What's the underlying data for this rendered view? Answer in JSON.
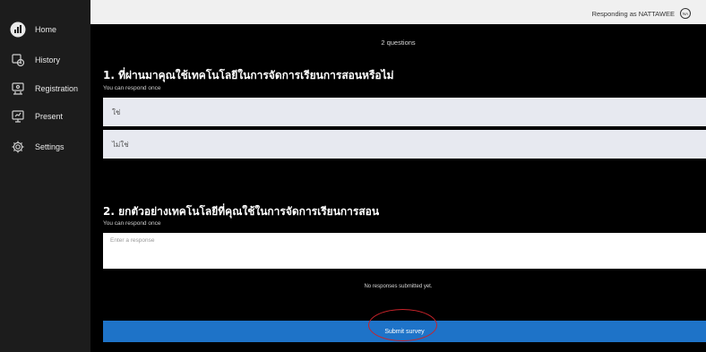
{
  "sidebar": {
    "items": [
      {
        "label": "Home",
        "icon": "home-logo-icon"
      },
      {
        "label": "History",
        "icon": "history-icon"
      },
      {
        "label": "Registration",
        "icon": "registration-icon"
      },
      {
        "label": "Present",
        "icon": "present-icon"
      },
      {
        "label": "Settings",
        "icon": "settings-gear-icon"
      }
    ]
  },
  "header": {
    "responding_as": "Responding as NATTAWEE",
    "avatar_initials": "NA"
  },
  "survey": {
    "question_count": "2 questions",
    "questions": [
      {
        "title": "1. ที่ผ่านมาคุณใช้เทคโนโลยีในการจัดการเรียนการสอนหรือไม่",
        "subtitle": "You can respond once",
        "options": [
          "ใช่",
          "ไม่ใช่"
        ]
      },
      {
        "title": "2. ยกตัวอย่างเทคโนโลยีที่คุณใช้ในการจัดการเรียนการสอน",
        "subtitle": "You can respond once",
        "placeholder": "Enter a response",
        "status": "No responses submitted yet."
      }
    ],
    "submit_label": "Submit survey"
  },
  "colors": {
    "sidebar_bg": "#1c1c1c",
    "submit_blue": "#1e73c8",
    "highlight_circle": "#c8232a"
  }
}
